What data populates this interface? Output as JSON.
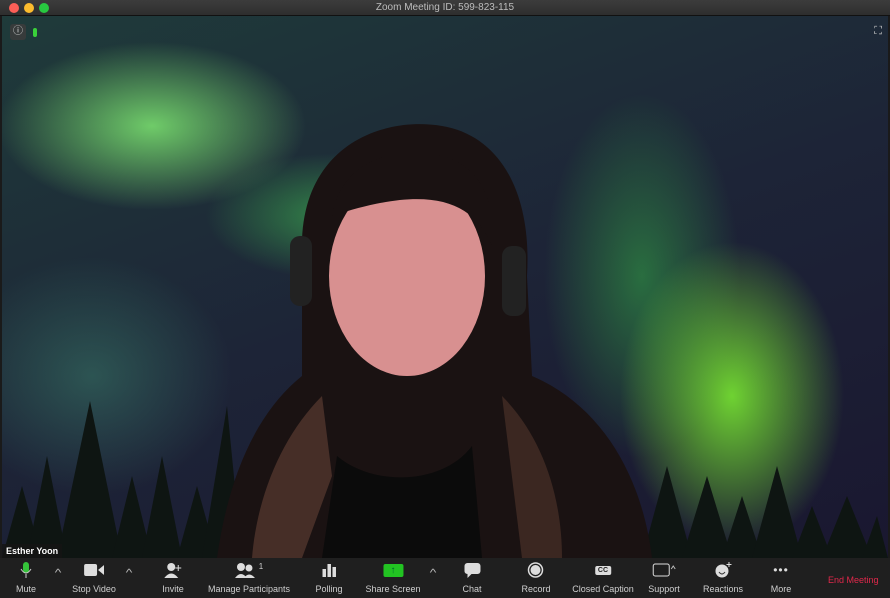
{
  "window": {
    "title": "Zoom Meeting ID: 599-823-115",
    "controls": {
      "close": "#fc5f57",
      "minimize": "#fdbc2e",
      "maximize": "#28c840"
    }
  },
  "video": {
    "participant_name": "Esther Yoon",
    "info_icon": "info-icon",
    "fullscreen_icon": "fullscreen-icon"
  },
  "toolbar": {
    "mute": "Mute",
    "stop_video": "Stop Video",
    "invite": "Invite",
    "manage_participants": "Manage Participants",
    "participant_count": "1",
    "polling": "Polling",
    "share_screen": "Share Screen",
    "chat": "Chat",
    "record": "Record",
    "closed_caption": "Closed Caption",
    "cc_icon_text": "CC",
    "support": "Support",
    "reactions": "Reactions",
    "more": "More",
    "end_meeting": "End Meeting",
    "share_color": "#22c322",
    "end_color": "#e0284b"
  }
}
